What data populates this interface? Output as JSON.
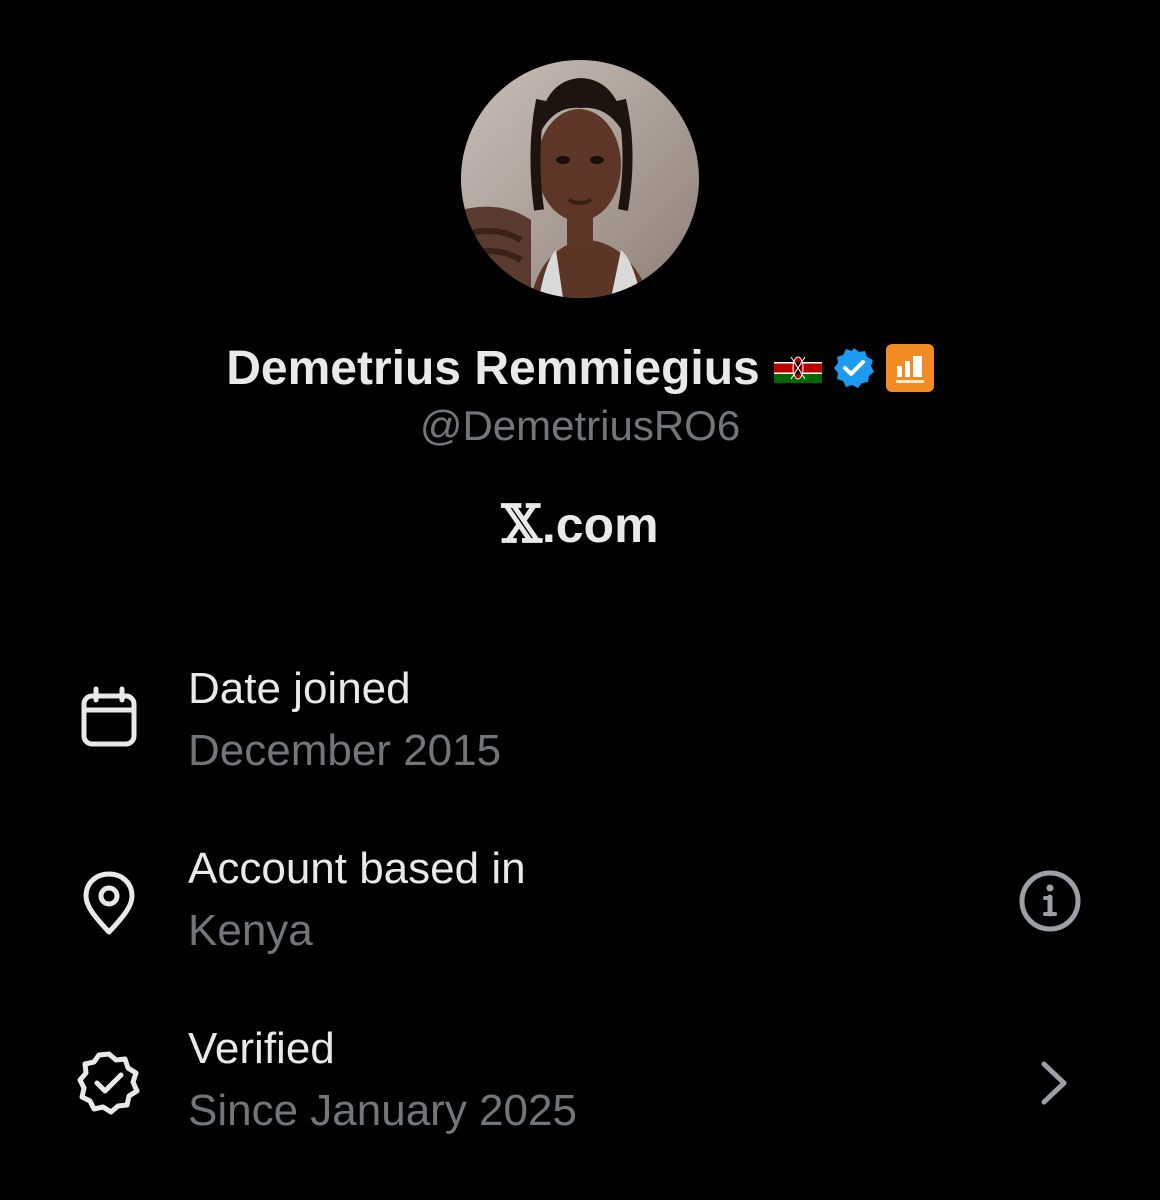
{
  "profile": {
    "display_name": "Demetrius Remmiegius",
    "handle": "@DemetriusRO6",
    "site_logo": "𝕏",
    "site_text": ".com",
    "badges": [
      "kenya-flag-icon",
      "verified-checkmark-icon",
      "affiliate-badge-icon"
    ]
  },
  "about": {
    "rows": [
      {
        "icon": "calendar-icon",
        "title": "Date joined",
        "subtitle": "December 2015"
      },
      {
        "icon": "location-pin-icon",
        "title": "Account based in",
        "subtitle": "Kenya",
        "action_icon": "info-icon"
      },
      {
        "icon": "verified-badge-outline-icon",
        "title": "Verified",
        "subtitle": "Since January 2025",
        "action_icon": "chevron-right-icon"
      }
    ]
  },
  "colors": {
    "background": "#000000",
    "primary_text": "#e7e9ea",
    "secondary_text": "#71767b",
    "verified_blue": "#1d9bf0",
    "affiliate_orange": "#f28b22"
  }
}
